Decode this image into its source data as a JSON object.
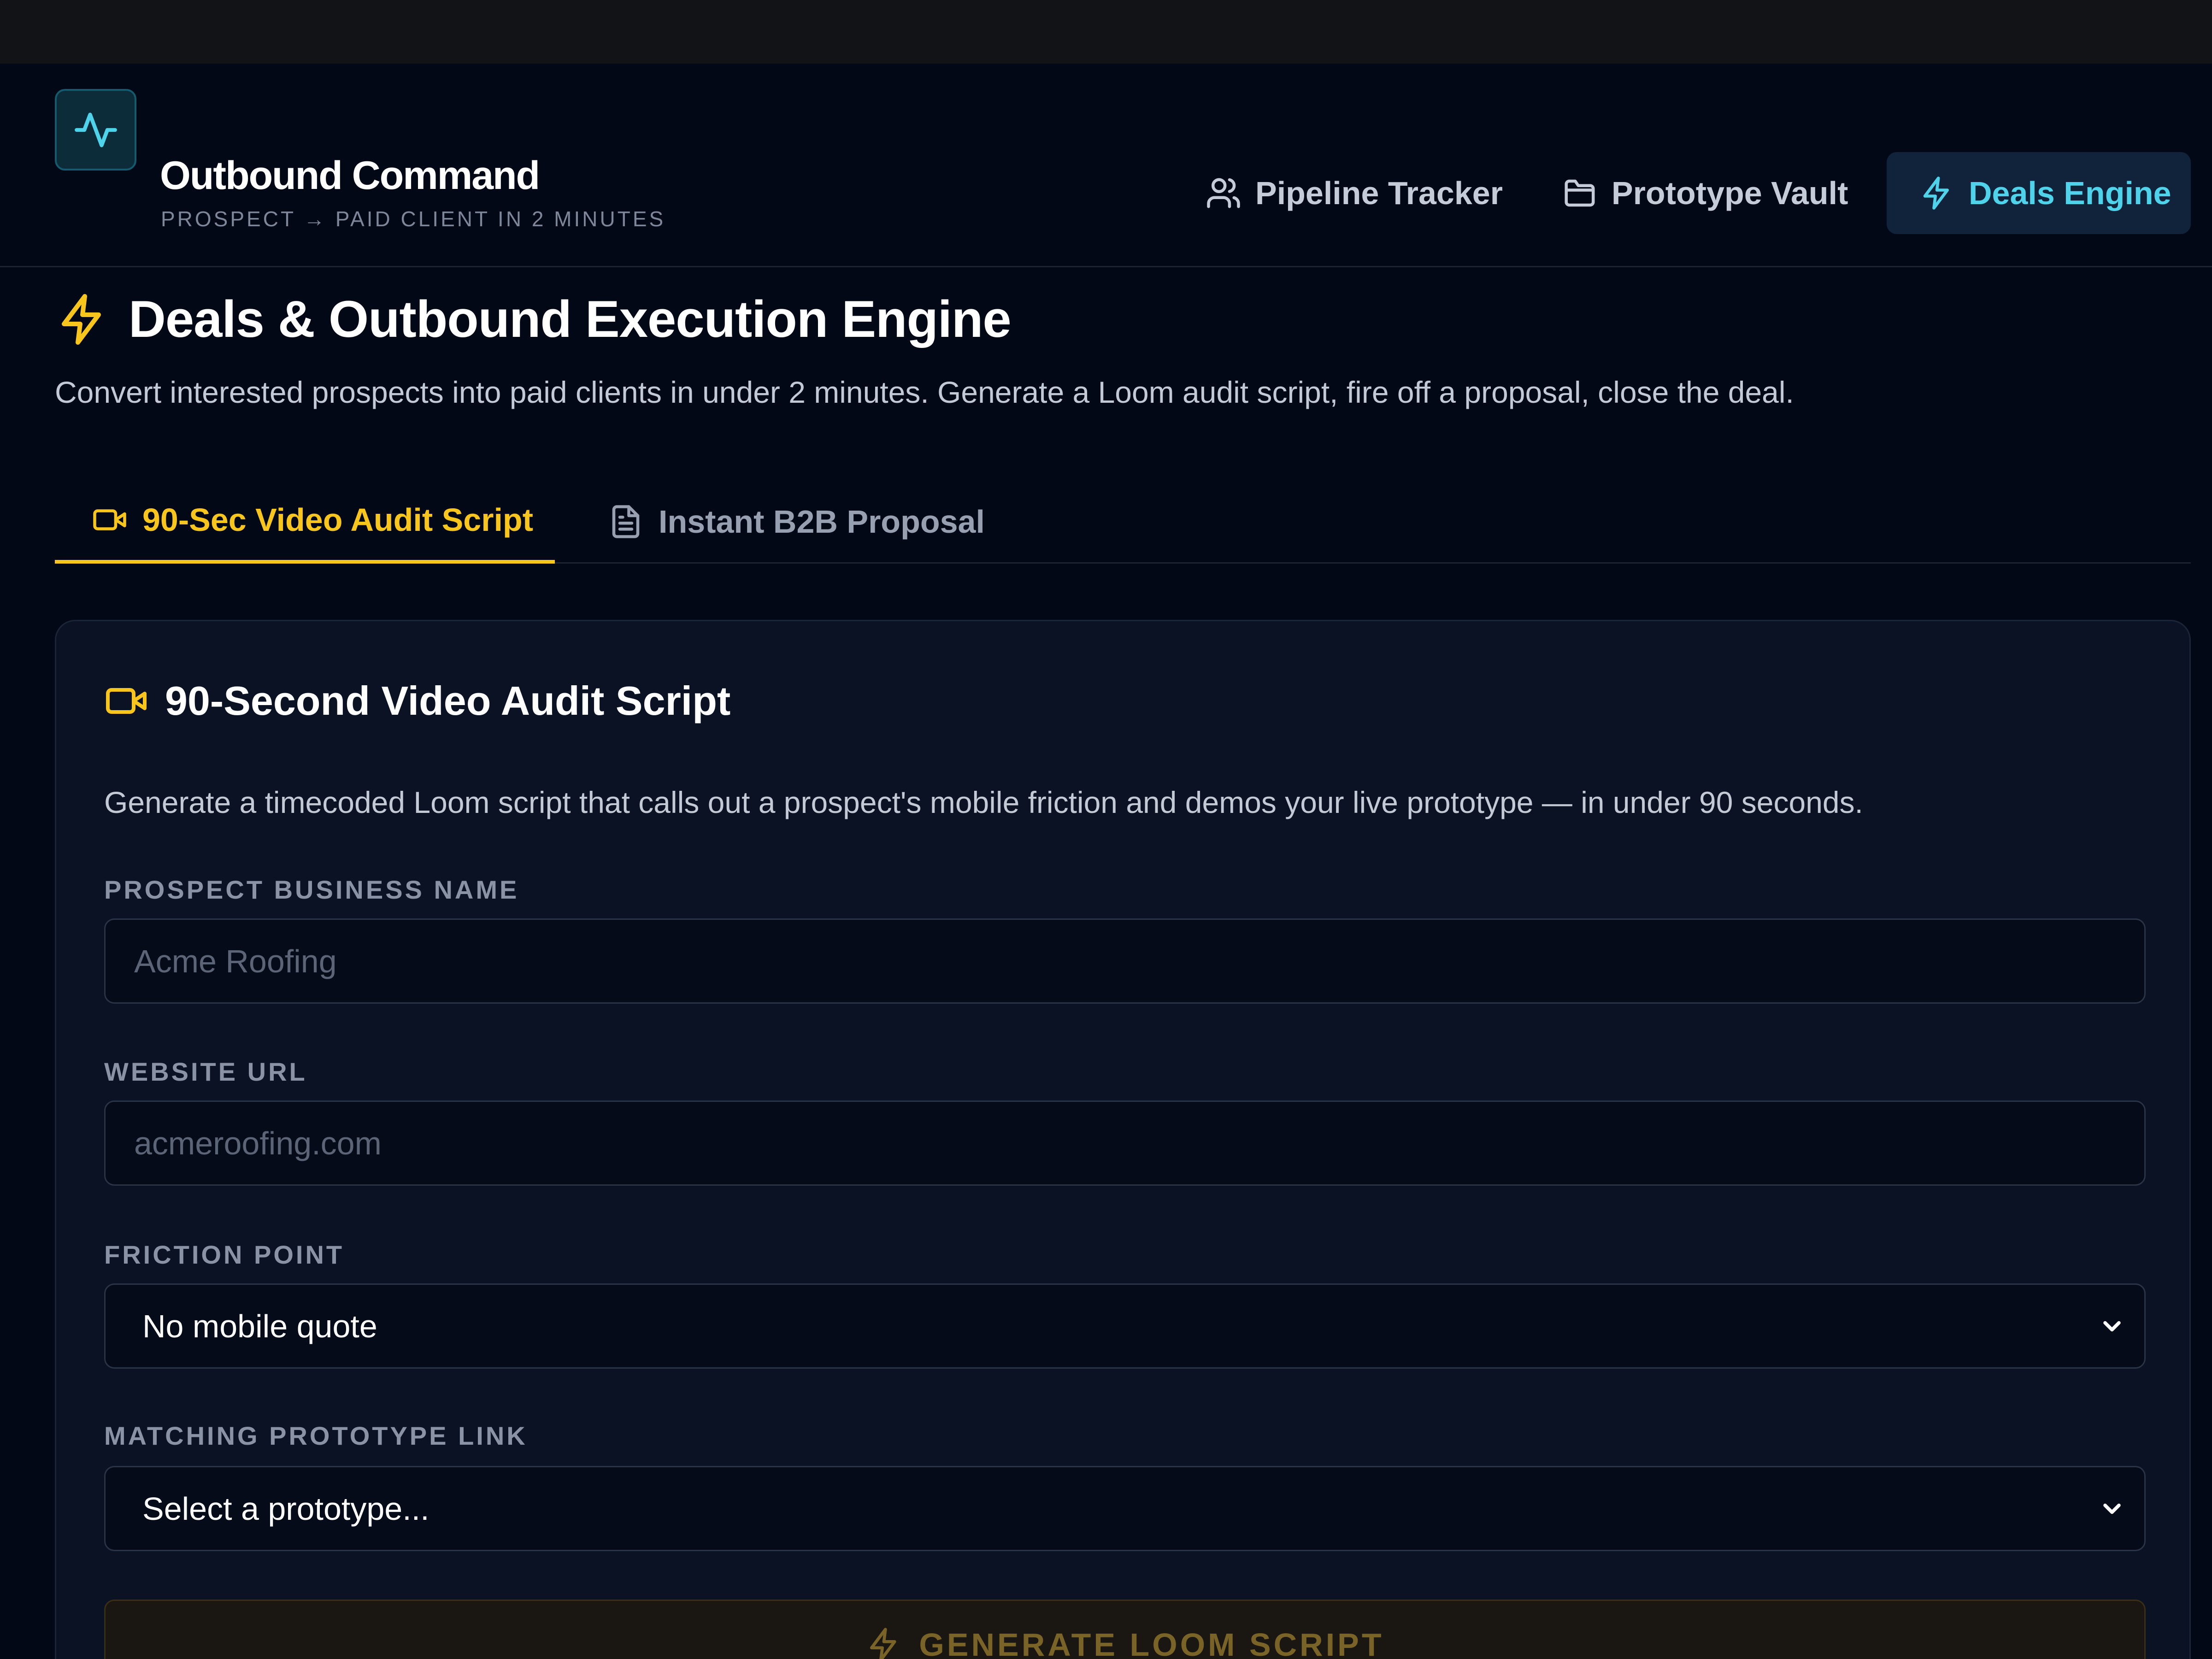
{
  "brand": {
    "title": "Outbound Command",
    "subtitle": "PROSPECT → PAID CLIENT IN 2 MINUTES",
    "icon": "activity-pulse-icon",
    "accent": "#4fd3ea"
  },
  "nav": {
    "pipeline_label": "Pipeline Tracker",
    "vault_label": "Prototype Vault",
    "deals_label": "Deals Engine",
    "active": "Deals Engine"
  },
  "page": {
    "title": "Deals & Outbound Execution Engine",
    "description": "Convert interested prospects into paid clients in under 2 minutes. Generate a Loom audit script, fire off a proposal, close the deal."
  },
  "tabs": {
    "video_label": "90-Sec Video Audit Script",
    "proposal_label": "Instant B2B Proposal",
    "active": "90-Sec Video Audit Script",
    "active_color": "#f8c51c"
  },
  "card": {
    "title": "90-Second Video Audit Script",
    "description": "Generate a timecoded Loom script that calls out a prospect's mobile friction and demos your live prototype — in under 90 seconds."
  },
  "form": {
    "business_name_label": "PROSPECT BUSINESS NAME",
    "business_name_value": "",
    "business_name_placeholder": "Acme Roofing",
    "website_label": "WEBSITE URL",
    "website_value": "",
    "website_placeholder": "acmeroofing.com",
    "friction_label": "FRICTION POINT",
    "friction_selected": "No mobile quote",
    "prototype_label": "MATCHING PROTOTYPE LINK",
    "prototype_selected": "Select a prototype...",
    "generate_label": "GENERATE LOOM SCRIPT"
  }
}
